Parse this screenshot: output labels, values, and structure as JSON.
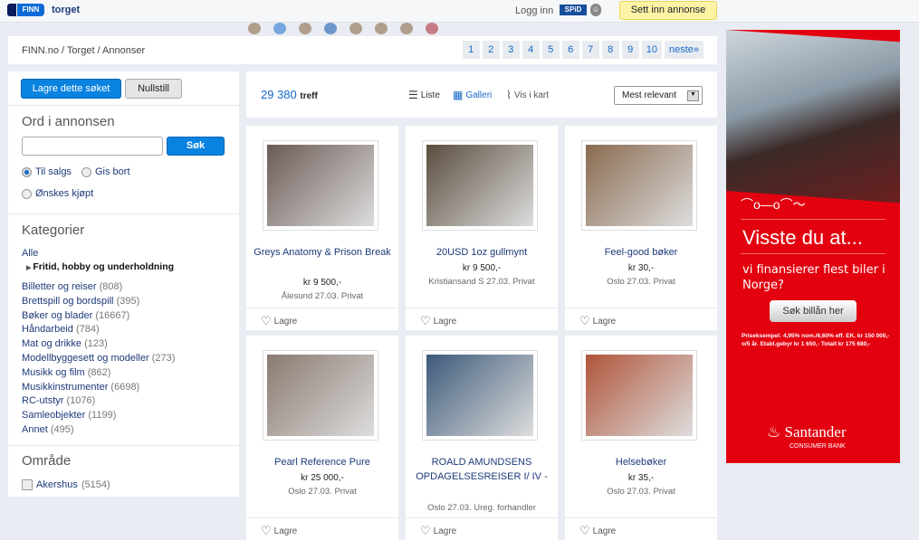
{
  "topbar": {
    "logo_text": "FINN",
    "section": "torget",
    "login": "Logg inn",
    "spid": "SPiD",
    "post_ad": "Sett inn annonse"
  },
  "breadcrumb": "FINN.no / Torget / Annonser",
  "pager": [
    "1",
    "2",
    "3",
    "4",
    "5",
    "6",
    "7",
    "8",
    "9",
    "10",
    "neste»"
  ],
  "sidebar": {
    "save_search": "Lagre dette søket",
    "reset": "Nullstill",
    "search_heading": "Ord i annonsen",
    "search_value": "",
    "search_button": "Søk",
    "radios": [
      {
        "label": "Til salgs",
        "checked": true
      },
      {
        "label": "Gis bort",
        "checked": false
      },
      {
        "label": "Ønskes kjøpt",
        "checked": false
      }
    ],
    "categories_heading": "Kategorier",
    "all": "Alle",
    "current": "Fritid, hobby og underholdning",
    "categories": [
      {
        "label": "Billetter og reiser",
        "count": "(808)"
      },
      {
        "label": "Brettspill og bordspill",
        "count": "(395)"
      },
      {
        "label": "Bøker og blader",
        "count": "(16667)"
      },
      {
        "label": "Håndarbeid",
        "count": "(784)"
      },
      {
        "label": "Mat og drikke",
        "count": "(123)"
      },
      {
        "label": "Modellbyggesett og modeller",
        "count": "(273)"
      },
      {
        "label": "Musikk og film",
        "count": "(862)"
      },
      {
        "label": "Musikkinstrumenter",
        "count": "(6698)"
      },
      {
        "label": "RC-utstyr",
        "count": "(1076)"
      },
      {
        "label": "Samleobjekter",
        "count": "(1199)"
      },
      {
        "label": "Annet",
        "count": "(495)"
      }
    ],
    "area_heading": "Område",
    "areas": [
      {
        "label": "Akershus",
        "count": "(5154)",
        "checked": false
      }
    ]
  },
  "results": {
    "count": "29 380",
    "count_label": "treff",
    "view_list": "Liste",
    "view_gallery": "Galleri",
    "view_map": "Vis i kart",
    "sort": "Mest relevant"
  },
  "listings": [
    {
      "title": "Greys Anatomy & Prison Break",
      "price": "kr 9 500,-",
      "location": "Ålesund 27.03. Privat",
      "save": "Lagre",
      "color": "#6b5a55"
    },
    {
      "title": "20USD 1oz gullmynt",
      "price": "kr 9 500,-",
      "location": "Kristiansand S 27.03. Privat",
      "save": "Lagre",
      "color": "#5a4d3e"
    },
    {
      "title": "Feel-good bøker",
      "price": "kr 30,-",
      "location": "Oslo 27.03. Privat",
      "save": "Lagre",
      "color": "#8a6a50"
    },
    {
      "title": "Pearl Reference Pure",
      "price": "kr 25 000,-",
      "location": "Oslo 27.03. Privat",
      "save": "Lagre",
      "color": "#8a7a70"
    },
    {
      "title": "ROALD AMUNDSENS OPDAGELSESREISER I/ IV -",
      "price": "",
      "location": "Oslo 27.03. Ureg. forhandler",
      "save": "Lagre",
      "color": "#3d5a7a"
    },
    {
      "title": "Helsebøker",
      "price": "kr 35,-",
      "location": "Oslo 27.03. Privat",
      "save": "Lagre",
      "color": "#b0543a"
    }
  ],
  "ad": {
    "headline": "Visste du at...",
    "text": "vi finansierer flest biler i Norge?",
    "button": "Søk billån her",
    "fine_print": "Priseksempel: 4,95% nom./6,60% eff. EK. kr 150 000,- o/5 år. Etabl.gebyr kr 1 650,- Totalt kr 175 680,-",
    "brand": "Santander",
    "brand_sub": "CONSUMER BANK",
    "color": "#e3000f"
  }
}
